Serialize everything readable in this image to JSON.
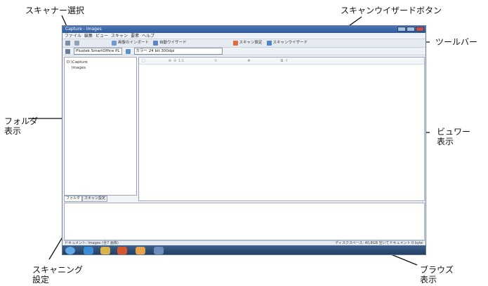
{
  "callouts": {
    "scanner_select": "スキャナー選択",
    "scan_wizard_button": "スキャンウイザードボタン",
    "toolbar": "ツールバー",
    "folder_view": [
      "フォルダ",
      "表示"
    ],
    "viewer_view": [
      "ビュワー",
      "表示"
    ],
    "scanning_settings": [
      "スキャニング",
      "設定"
    ],
    "browse_view": [
      "ブラウズ",
      "表示"
    ]
  },
  "window": {
    "title": "Capture - Images",
    "menu": [
      "ファイル",
      "編集",
      "ビュー",
      "スキャン",
      "要素",
      "ヘルプ"
    ]
  },
  "toolbar": {
    "buttons": [
      "画像のインポート",
      "自動ウイザード",
      "スキャン設定",
      "スキャンウイザード"
    ],
    "scanner_value": "Plustek SmartOffice PL",
    "color_value": "カラー 24 bit 300dpi"
  },
  "folder": {
    "items": [
      "D:\\Capture",
      "Images"
    ]
  },
  "tabs": [
    "フォルダ",
    "スキャン設定"
  ],
  "status": {
    "left": "ドキュメント: Images (全7 画像)",
    "right": "ディスクスペース: 40,8GB 空いてドキュメント 0 byte"
  },
  "colors": {
    "title_bar": "#2f5a9b",
    "taskbar": "#1f3a5f",
    "panel_border": "#9aa6b8"
  }
}
